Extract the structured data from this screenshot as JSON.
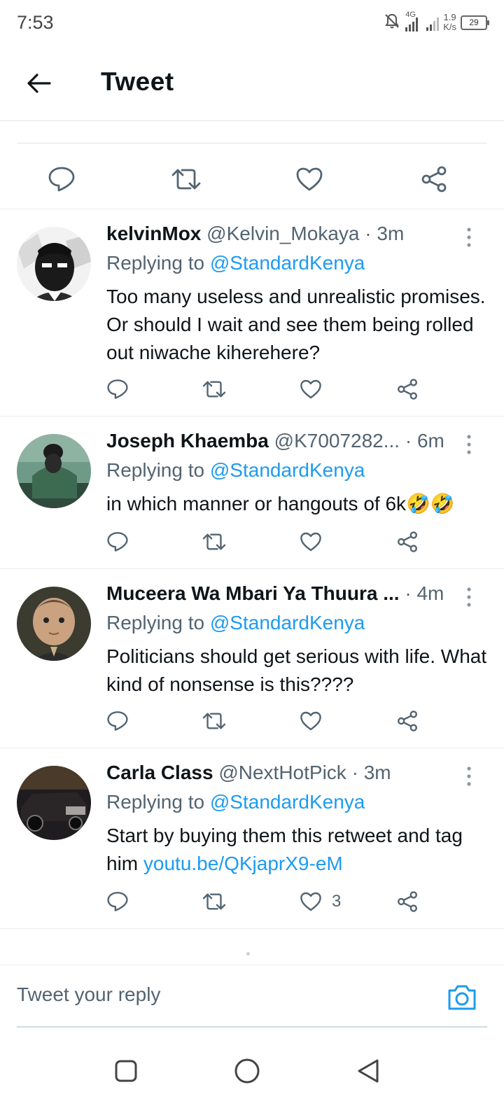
{
  "status_bar": {
    "time": "7:53",
    "network": "4G",
    "speed_value": "1.9",
    "speed_unit": "K/s",
    "battery": "29",
    "icons": [
      "mute-bell-icon",
      "signal-icon",
      "signal-icon-2",
      "battery-icon"
    ]
  },
  "header": {
    "title": "Tweet",
    "back_icon": "arrow-left-icon"
  },
  "main_tweet_actions": [
    "reply-icon",
    "retweet-icon",
    "like-icon",
    "share-icon"
  ],
  "replies": [
    {
      "name": "kelvinMox",
      "handle": "@Kelvin_Mokaya",
      "sep": "·",
      "time": "3m",
      "replying_prefix": "Replying to",
      "replying_to": "@StandardKenya",
      "text": "Too many useless and unrealistic promises. Or should I wait and see them being rolled out niwache kiherehere?",
      "likes": ""
    },
    {
      "name": "Joseph Khaemba",
      "handle": "@K7007282...",
      "sep": "·",
      "time": "6m",
      "replying_prefix": "Replying to",
      "replying_to": "@StandardKenya",
      "text": "in which manner or hangouts of 6k🤣🤣",
      "likes": ""
    },
    {
      "name": "Muceera Wa Mbari Ya Thuura ...",
      "handle": "",
      "sep": "·",
      "time": "4m",
      "replying_prefix": "Replying to",
      "replying_to": "@StandardKenya",
      "text": "Politicians should get serious with life. What kind of nonsense is this????",
      "likes": ""
    },
    {
      "name": "Carla Class",
      "handle": "@NextHotPick",
      "sep": "·",
      "time": "3m",
      "replying_prefix": "Replying to",
      "replying_to": "@StandardKenya",
      "text": "Start by buying them this retweet and tag him ",
      "link": "youtu.be/QKjaprX9-eM",
      "likes": "3"
    }
  ],
  "reply_bar": {
    "placeholder": "Tweet your reply",
    "camera_icon": "camera-icon"
  },
  "nav_bar": [
    "recents-square-icon",
    "home-circle-icon",
    "back-triangle-icon"
  ],
  "colors": {
    "accent": "#1d9bf0",
    "text": "#0f1419",
    "secondary": "#536471"
  }
}
